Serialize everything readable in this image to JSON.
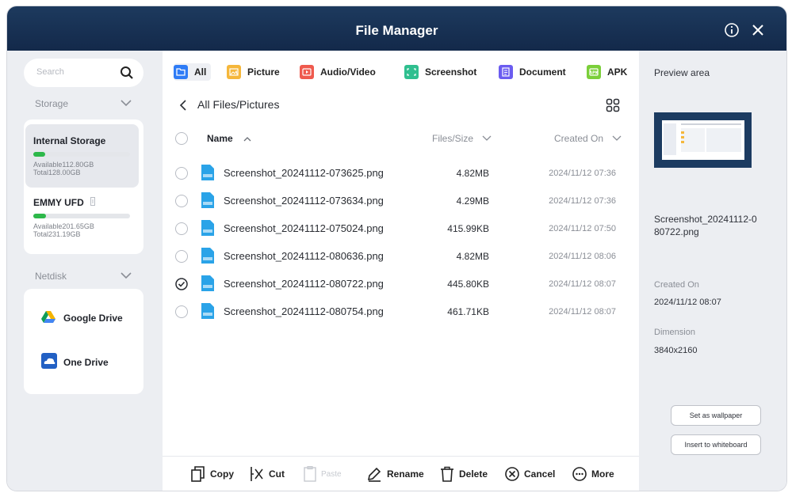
{
  "window": {
    "title": "File Manager"
  },
  "sidebar": {
    "search_placeholder": "Search",
    "storage_label": "Storage",
    "drives": [
      {
        "name": "Internal Storage",
        "available": "Available112.80GB",
        "total": "Total128.00GB",
        "usage": 0.12
      },
      {
        "name": "EMMY UFD",
        "available": "Available201.65GB",
        "total": "Total231.19GB",
        "usage": 0.13
      }
    ],
    "netdisk_label": "Netdisk",
    "netdisks": [
      {
        "name": "Google Drive"
      },
      {
        "name": "One Drive"
      }
    ]
  },
  "tabs": [
    {
      "label": "All",
      "color": "#2f7cf6"
    },
    {
      "label": "Picture",
      "color": "#f5b73b"
    },
    {
      "label": "Audio/Video",
      "color": "#ef5a4e"
    },
    {
      "label": "Screenshot",
      "color": "#2fbf8f"
    },
    {
      "label": "Document",
      "color": "#6b5cf0"
    },
    {
      "label": "APK",
      "color": "#7bcf3a"
    }
  ],
  "breadcrumb": "All Files/Pictures",
  "columns": {
    "name": "Name",
    "size": "Files/Size",
    "created": "Created On"
  },
  "files": [
    {
      "name": "Screenshot_20241112-073625.png",
      "size": "4.82MB",
      "created": "2024/11/12 07:36",
      "selected": false
    },
    {
      "name": "Screenshot_20241112-073634.png",
      "size": "4.29MB",
      "created": "2024/11/12 07:36",
      "selected": false
    },
    {
      "name": "Screenshot_20241112-075024.png",
      "size": "415.99KB",
      "created": "2024/11/12 07:50",
      "selected": false
    },
    {
      "name": "Screenshot_20241112-080636.png",
      "size": "4.82MB",
      "created": "2024/11/12 08:06",
      "selected": false
    },
    {
      "name": "Screenshot_20241112-080722.png",
      "size": "445.80KB",
      "created": "2024/11/12 08:07",
      "selected": true
    },
    {
      "name": "Screenshot_20241112-080754.png",
      "size": "461.71KB",
      "created": "2024/11/12 08:07",
      "selected": false
    }
  ],
  "toolbar": {
    "copy": "Copy",
    "cut": "Cut",
    "paste": "Paste",
    "rename": "Rename",
    "delete": "Delete",
    "cancel": "Cancel",
    "more": "More"
  },
  "preview": {
    "title": "Preview area",
    "filename_line1": "Screenshot_20241112-0",
    "filename_line2": "80722.png",
    "created_label": "Created On",
    "created_value": "2024/11/12 08:07",
    "dimension_label": "Dimension",
    "dimension_value": "3840x2160",
    "wallpaper_button": "Set as wallpaper",
    "whiteboard_button": "Insert to whiteboard"
  }
}
